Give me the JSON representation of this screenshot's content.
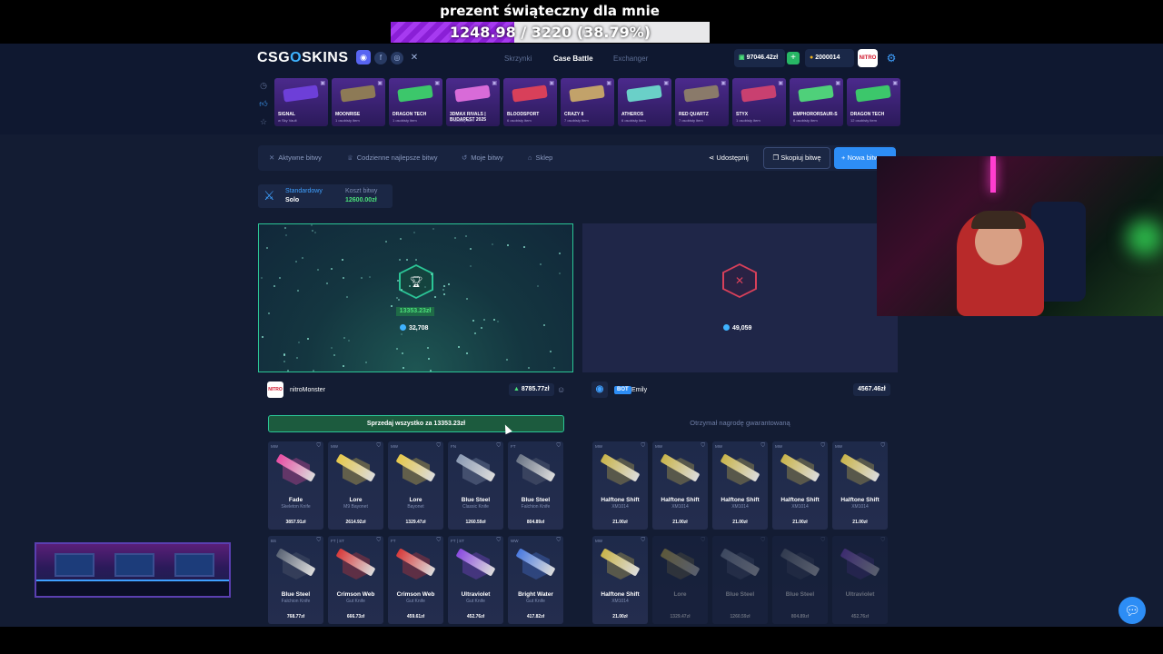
{
  "stream": {
    "goal_title": "prezent świąteczny dla mnie",
    "goal_text": "1248.98 / 3220 (38.79%)",
    "goal_progress": 0.3879
  },
  "header": {
    "logo_left": "CSG",
    "logo_mid": "O",
    "logo_right": "SKINS",
    "nav": [
      "Skrzynki",
      "Case Battle",
      "Exchanger"
    ],
    "balance": "97046.42zł",
    "coins": "2000014",
    "avatar_text": "NITRO"
  },
  "live_drops": [
    {
      "name": "SIGNAL",
      "sub": "w Sky Vault",
      "color": "#6d3fd8"
    },
    {
      "name": "MOONRISE",
      "sub": "1 osobisty item",
      "color": "#8d7a56"
    },
    {
      "name": "DRAGON TECH",
      "sub": "1 osobisty item",
      "color": "#3cc76b"
    },
    {
      "name": "3DMAX RIVALS | BUDAPEST 2025",
      "sub": "1 osobisty item",
      "color": "#d86bd8"
    },
    {
      "name": "BLOODSPORT",
      "sub": "6 osobisty item",
      "color": "#d8405a"
    },
    {
      "name": "CRAZY 8",
      "sub": "7 osobisty item",
      "color": "#c2a26a"
    },
    {
      "name": "ATHEROS",
      "sub": "6 osobisty item",
      "color": "#6ad0c8"
    },
    {
      "name": "RED QUARTZ",
      "sub": "7 osobisty item",
      "color": "#8a7a6a"
    },
    {
      "name": "STYX",
      "sub": "1 osobisty item",
      "color": "#c94070"
    },
    {
      "name": "EMPHORORSAUR-S",
      "sub": "6 osobisty item",
      "color": "#4fd07a"
    },
    {
      "name": "DRAGON TECH",
      "sub": "12 osobisty item",
      "color": "#3cc76b"
    }
  ],
  "tabs": {
    "active": "Aktywne bitwy",
    "daily": "Codzienne najlepsze bitwy",
    "mine": "Moje bitwy",
    "shop": "Sklep",
    "share": "Udostępnij",
    "copy": "Skopiuj bitwę",
    "new": "Nowa bitwa"
  },
  "mode": {
    "label": "Standardowy",
    "value": "Solo",
    "cost_label": "Koszt bitwy",
    "cost_value": "12600.00zł"
  },
  "left_arena": {
    "win_amount": "13353.23zł",
    "coins": "32,708"
  },
  "right_arena": {
    "coins": "49,059"
  },
  "left_player": {
    "name": "nitroMonster",
    "avatar": "NITRO",
    "amount": "8785.77zł",
    "sell": "Sprzedaj wszystko za 13353.23zł"
  },
  "right_player": {
    "badge": "BOT",
    "name": "Emily",
    "amount": "4567.46zł",
    "guaranteed": "Otrzymał nagrodę gwarantowaną"
  },
  "left_items": [
    {
      "wear": "MW",
      "name": "Fade",
      "sub": "Skeleton Knife",
      "price": "3857.91zł",
      "color": "#e84da3"
    },
    {
      "wear": "MW",
      "name": "Lore",
      "sub": "M9 Bayonet",
      "price": "2614.92zł",
      "color": "#e6c84a"
    },
    {
      "wear": "MW",
      "name": "Lore",
      "sub": "Bayonet",
      "price": "1329.47zł",
      "color": "#e6c84a"
    },
    {
      "wear": "FN",
      "name": "Blue Steel",
      "sub": "Classic Knife",
      "price": "1260.59zł",
      "color": "#8b9ab3"
    },
    {
      "wear": "FT",
      "name": "Blue Steel",
      "sub": "Falchion Knife",
      "price": "804.89zł",
      "color": "#6b7586"
    },
    {
      "wear": "BS",
      "name": "Blue Steel",
      "sub": "Falchion Knife",
      "price": "768.77zł",
      "color": "#5a6475"
    },
    {
      "wear": "FT | ST",
      "name": "Crimson Web",
      "sub": "Gut Knife",
      "price": "666.73zł",
      "color": "#d83a3a"
    },
    {
      "wear": "FT",
      "name": "Crimson Web",
      "sub": "Gut Knife",
      "price": "459.61zł",
      "color": "#d83a3a"
    },
    {
      "wear": "FT | ST",
      "name": "Ultraviolet",
      "sub": "Gut Knife",
      "price": "452.76zł",
      "color": "#8a4ae0"
    },
    {
      "wear": "WW",
      "name": "Bright Water",
      "sub": "Gut Knife",
      "price": "417.82zł",
      "color": "#4a7ae0"
    }
  ],
  "right_items": [
    {
      "wear": "MW",
      "name": "Halftone Shift",
      "sub": "XM1014",
      "price": "21.00zł",
      "color": "#c9b44a",
      "dim": false
    },
    {
      "wear": "MW",
      "name": "Halftone Shift",
      "sub": "XM1014",
      "price": "21.00zł",
      "color": "#c9b44a",
      "dim": false
    },
    {
      "wear": "MW",
      "name": "Halftone Shift",
      "sub": "XM1014",
      "price": "21.00zł",
      "color": "#c9b44a",
      "dim": false
    },
    {
      "wear": "MW",
      "name": "Halftone Shift",
      "sub": "XM1014",
      "price": "21.00zł",
      "color": "#c9b44a",
      "dim": false
    },
    {
      "wear": "MW",
      "name": "Halftone Shift",
      "sub": "XM1014",
      "price": "21.00zł",
      "color": "#c9b44a",
      "dim": false
    },
    {
      "wear": "MW",
      "name": "Halftone Shift",
      "sub": "XM1014",
      "price": "21.00zł",
      "color": "#c9b44a",
      "dim": false
    },
    {
      "wear": "",
      "name": "Lore",
      "sub": "",
      "price": "1329.47zł",
      "color": "#e6c84a",
      "dim": true
    },
    {
      "wear": "",
      "name": "Blue Steel",
      "sub": "",
      "price": "1260.59zł",
      "color": "#8b9ab3",
      "dim": true
    },
    {
      "wear": "",
      "name": "Blue Steel",
      "sub": "",
      "price": "804.89zł",
      "color": "#6b7586",
      "dim": true
    },
    {
      "wear": "",
      "name": "Ultraviolet",
      "sub": "",
      "price": "452.76zł",
      "color": "#8a4ae0",
      "dim": true
    }
  ]
}
